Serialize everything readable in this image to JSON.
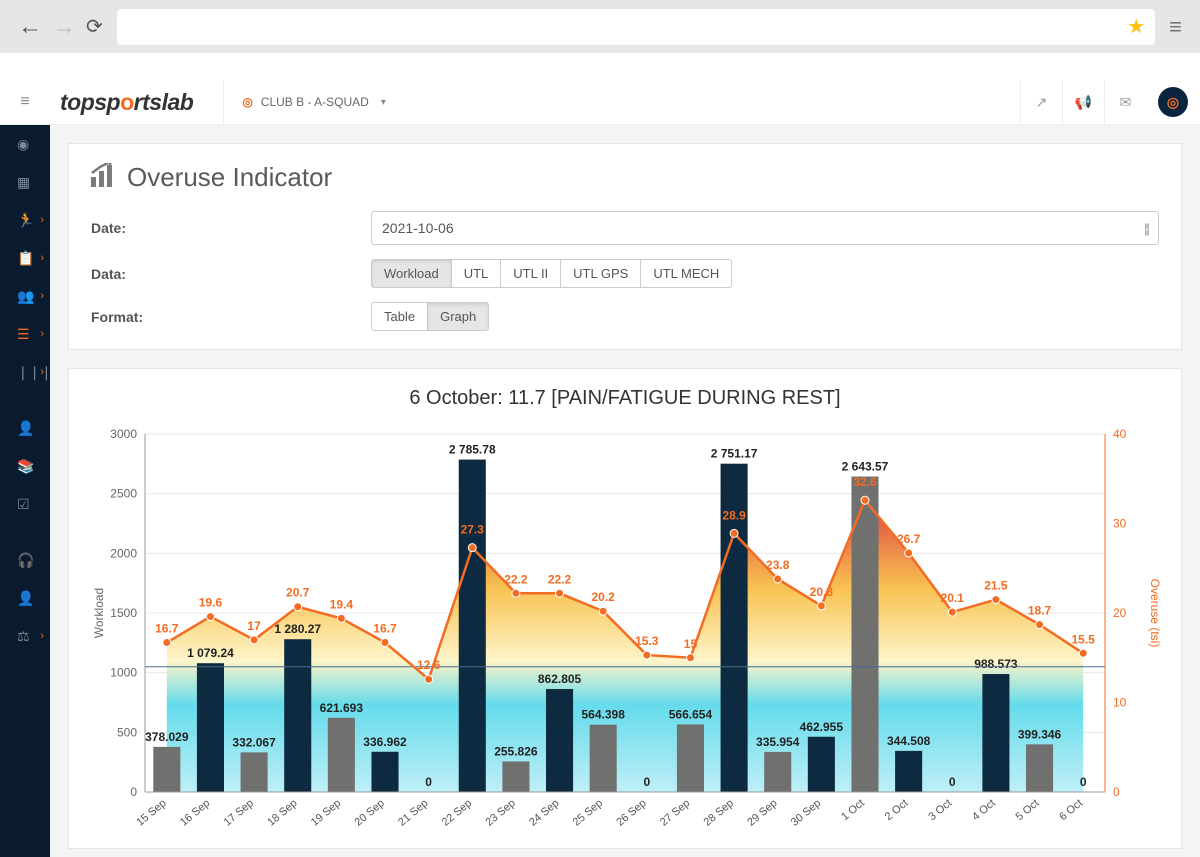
{
  "browser": {
    "star": "★",
    "menu": "≡"
  },
  "brand": {
    "pre": "topsp",
    "o": "o",
    "post": "rtslab"
  },
  "squad": {
    "label": "CLUB B - A-SQUAD"
  },
  "page": {
    "title": "Overuse Indicator",
    "labels": {
      "date": "Date:",
      "data": "Data:",
      "format": "Format:"
    },
    "date_value": "2021-10-06",
    "data_buttons": [
      "Workload",
      "UTL",
      "UTL II",
      "UTL GPS",
      "UTL MECH"
    ],
    "data_active": 0,
    "format_buttons": [
      "Table",
      "Graph"
    ],
    "format_active": 1
  },
  "sidebar": {
    "items": [
      {
        "name": "dashboard-icon",
        "sub": false,
        "active": false
      },
      {
        "name": "calendar-icon",
        "sub": false,
        "active": false
      },
      {
        "name": "running-icon",
        "sub": true,
        "active": false
      },
      {
        "name": "clipboard-icon",
        "sub": true,
        "active": false
      },
      {
        "name": "users-icon",
        "sub": true,
        "active": false
      },
      {
        "name": "list-icon",
        "sub": true,
        "active": true
      },
      {
        "name": "bars-icon",
        "sub": true,
        "active": false
      },
      {
        "name": "sep"
      },
      {
        "name": "user-circle-icon",
        "sub": false,
        "active": false
      },
      {
        "name": "books-icon",
        "sub": false,
        "active": false
      },
      {
        "name": "checklist-icon",
        "sub": false,
        "active": false
      },
      {
        "name": "sep"
      },
      {
        "name": "headset-icon",
        "sub": false,
        "active": false
      },
      {
        "name": "profile-icon",
        "sub": false,
        "active": false
      },
      {
        "name": "balance-icon",
        "sub": true,
        "active": false
      }
    ]
  },
  "chart_data": {
    "type": "bar+line",
    "title": "6 October: 11.7 [PAIN/FATIGUE DURING REST]",
    "y1label": "Workload",
    "y2label": "Overuse (tsl)",
    "y1lim": [
      0,
      3000
    ],
    "y1ticks": [
      0,
      500,
      1000,
      1500,
      2000,
      2500,
      3000
    ],
    "y2lim": [
      0,
      40
    ],
    "y2ticks": [
      0,
      10,
      20,
      30,
      40
    ],
    "categories": [
      "15 Sep",
      "16 Sep",
      "17 Sep",
      "18 Sep",
      "19 Sep",
      "20 Sep",
      "21 Sep",
      "22 Sep",
      "23 Sep",
      "24 Sep",
      "25 Sep",
      "26 Sep",
      "27 Sep",
      "28 Sep",
      "29 Sep",
      "30 Sep",
      "1 Oct",
      "2 Oct",
      "3 Oct",
      "4 Oct",
      "5 Oct",
      "6 Oct"
    ],
    "series": [
      {
        "name": "Workload",
        "kind": "bar",
        "values": [
          378.029,
          1079.24,
          332.067,
          1280.27,
          621.693,
          336.962,
          0,
          2785.78,
          255.826,
          862.805,
          564.398,
          0,
          566.654,
          2751.17,
          335.954,
          462.955,
          2643.57,
          344.508,
          0,
          988.573,
          399.346,
          0
        ],
        "labels": [
          "378.029",
          "1 079.24",
          "332.067",
          "1 280.27",
          "621.693",
          "336.962",
          "0",
          "2 785.78",
          "255.826",
          "862.805",
          "564.398",
          "0",
          "566.654",
          "2 751.17",
          "335.954",
          "462.955",
          "2 643.57",
          "344.508",
          "0",
          "988.573",
          "399.346",
          "0"
        ],
        "odd_color": "#70706f",
        "even_color": "#0e2a40"
      },
      {
        "name": "Overuse",
        "kind": "line",
        "values": [
          16.7,
          19.6,
          17,
          20.7,
          19.4,
          16.7,
          12.6,
          27.3,
          22.2,
          22.2,
          20.2,
          15.3,
          15,
          28.9,
          23.8,
          20.8,
          32.6,
          26.7,
          20.1,
          21.5,
          18.7,
          15.5
        ],
        "labels": [
          "16.7",
          "19.6",
          "17",
          "20.7",
          "19.4",
          "16.7",
          "12.6",
          "27.3",
          "22.2",
          "22.2",
          "20.2",
          "15.3",
          "15",
          "28.9",
          "23.8",
          "20.8",
          "32.6",
          "26.7",
          "20.1",
          "21.5",
          "18.7",
          "15.5"
        ],
        "color": "#f36c21"
      }
    ]
  }
}
